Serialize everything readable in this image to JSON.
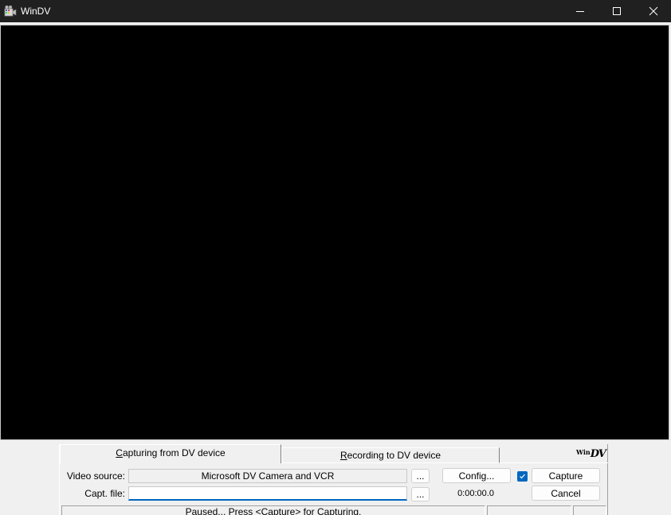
{
  "window": {
    "title": "WinDV"
  },
  "tabs": {
    "capture_underline": "C",
    "capture_rest": "apturing from DV device",
    "record_underline": "R",
    "record_rest": "ecording to DV device"
  },
  "logo": {
    "win": "Win",
    "dv": "DV"
  },
  "form": {
    "video_source_label": "Video source:",
    "video_source_value": "Microsoft DV Camera and VCR",
    "capt_file_label": "Capt. file:",
    "capt_file_value": "",
    "browse_label": "...",
    "config_label": "Config...",
    "capture_label": "Capture",
    "cancel_label": "Cancel",
    "timecode": "0:00:00.0"
  },
  "status": {
    "main": "Paused... Press <Capture> for Capturing.",
    "second": "",
    "third": ""
  },
  "colors": {
    "titlebar": "#202020",
    "preview": "#000000",
    "accent": "#0067c0",
    "panel": "#f0f0f0"
  }
}
